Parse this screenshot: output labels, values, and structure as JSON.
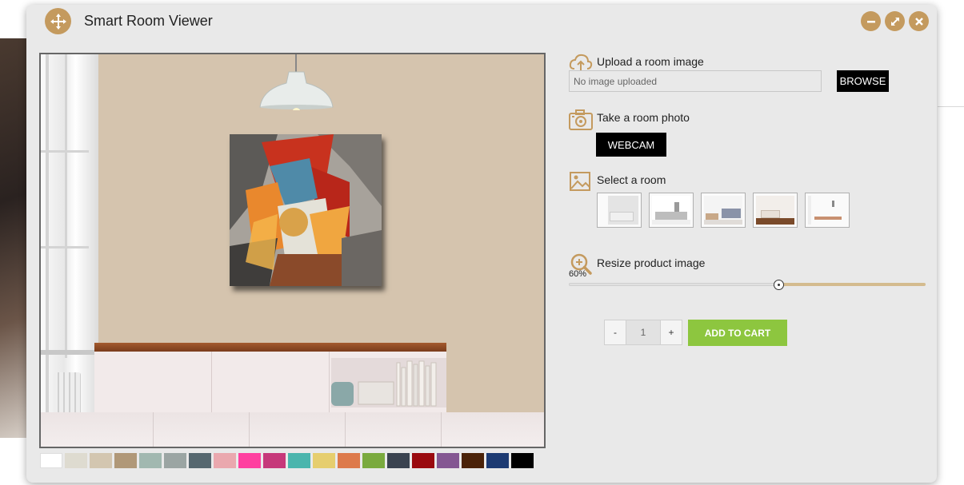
{
  "window": {
    "title": "Smart Room Viewer"
  },
  "upload": {
    "label": "Upload a room image",
    "placeholder": "No image uploaded",
    "browse_label": "BROWSE"
  },
  "photo": {
    "label": "Take a room photo",
    "webcam_label": "WEBCAM"
  },
  "rooms": {
    "label": "Select a room",
    "count": 5
  },
  "resize": {
    "label": "Resize product image",
    "value": "60%",
    "level": 0.6
  },
  "cart": {
    "minus": "-",
    "quantity": "1",
    "plus": "+",
    "add_label": "ADD TO CART"
  },
  "wall_colors": [
    "#ffffff",
    "#dedbd0",
    "#d3c6b0",
    "#b09878",
    "#a1b8b0",
    "#9ba5a3",
    "#56686f",
    "#eaa8ae",
    "#ff40a0",
    "#c6387a",
    "#4ab5ad",
    "#e6ce6e",
    "#dd7a4b",
    "#7aaa3e",
    "#3a4350",
    "#9a0a0f",
    "#845792",
    "#4a2208",
    "#1c3a72",
    "#000000"
  ],
  "colors": {
    "accent": "#c49a5e",
    "cart_green": "#8dc63f",
    "wall": "#d5c4ae"
  }
}
